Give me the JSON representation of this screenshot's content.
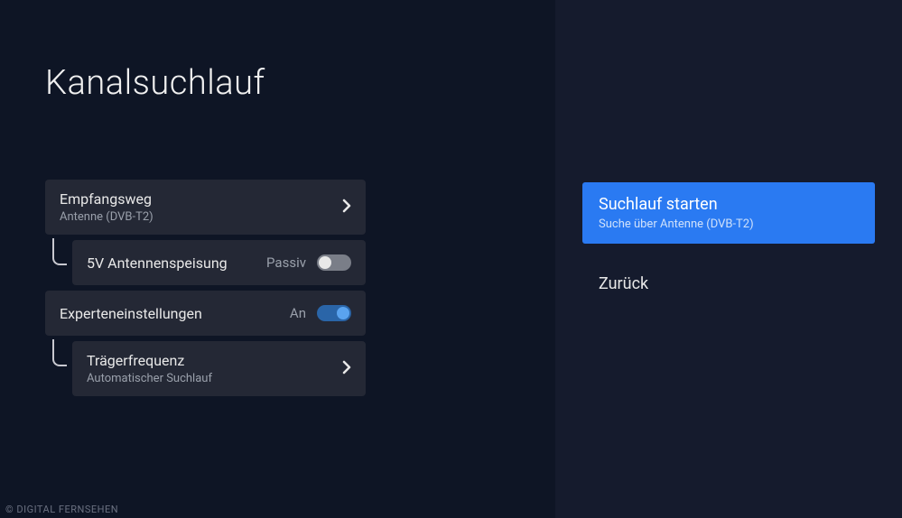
{
  "title": "Kanalsuchlauf",
  "settings": {
    "reception": {
      "label": "Empfangsweg",
      "value": "Antenne (DVB-T2)"
    },
    "antenna_power": {
      "label": "5V Antennenspeisung",
      "state": "Passiv",
      "on": false
    },
    "expert": {
      "label": "Experteneinstellungen",
      "state": "An",
      "on": true
    },
    "carrier": {
      "label": "Trägerfrequenz",
      "value": "Automatischer Suchlauf"
    }
  },
  "actions": {
    "start": {
      "title": "Suchlauf starten",
      "subtitle": "Suche über Antenne (DVB-T2)"
    },
    "back": "Zurück"
  },
  "watermark": "© DIGITAL FERNSEHEN"
}
